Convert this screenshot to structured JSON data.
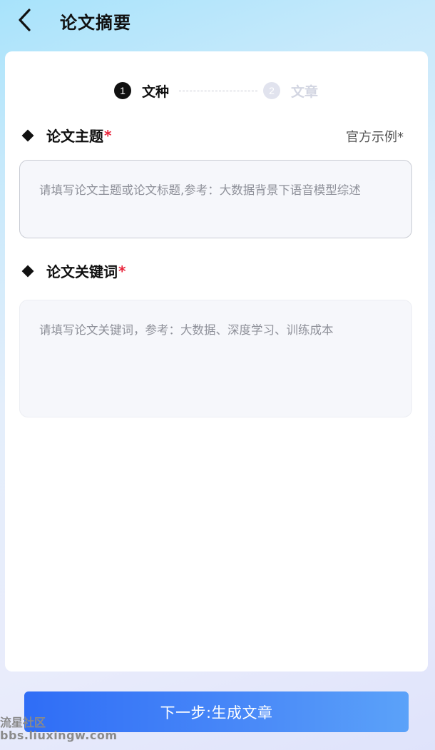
{
  "header": {
    "title": "论文摘要",
    "back_icon": "chevron-left-icon"
  },
  "steps": [
    {
      "number": "1",
      "label": "文种",
      "state": "active"
    },
    {
      "number": "2",
      "label": "文章",
      "state": "inactive"
    }
  ],
  "topic": {
    "label": "论文主题",
    "required_mark": "*",
    "example_link": "官方示例*",
    "placeholder": "请填写论文主题或论文标题,参考：大数据背景下语音模型综述",
    "value": ""
  },
  "keywords": {
    "label": "论文关键词",
    "required_mark": "*",
    "placeholder": "请填写论文关键词，参考：大数据、深度学习、训练成本",
    "value": ""
  },
  "footer": {
    "next_button": "下一步:生成文章"
  },
  "watermark": {
    "line1": "流星社区",
    "line2": "bbs.liuxingw.com"
  },
  "colors": {
    "accent": "#3b7cf7",
    "required": "#e8233a",
    "step_inactive": "#d3d6e2"
  }
}
